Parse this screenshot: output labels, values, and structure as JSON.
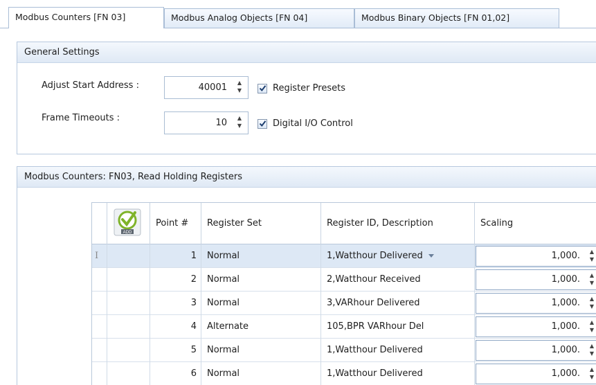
{
  "tabs": [
    {
      "label": "Modbus Counters [FN 03]",
      "active": true
    },
    {
      "label": "Modbus Analog Objects [FN 04]",
      "active": false
    },
    {
      "label": "Modbus Binary Objects  [FN 01,02]",
      "active": false
    }
  ],
  "general": {
    "title": "General Settings",
    "start_label": "Adjust Start Address :",
    "start_value": "40001",
    "timeout_label": "Frame Timeouts :",
    "timeout_value": "10",
    "register_presets": {
      "label": "Register Presets",
      "checked": true
    },
    "digital_io": {
      "label": "Digital I/O Control",
      "checked": true
    }
  },
  "counters": {
    "title": "Modbus Counters: FN03, Read Holding Registers",
    "add_icon_label": "ADD",
    "columns": [
      "Point #",
      "Register Set",
      "Register ID, Description",
      "Scaling"
    ],
    "rows": [
      {
        "point": "1",
        "set": "Normal",
        "reg": "1,Watthour Delivered",
        "scaling": "1,000."
      },
      {
        "point": "2",
        "set": "Normal",
        "reg": "2,Watthour Received",
        "scaling": "1,000."
      },
      {
        "point": "3",
        "set": "Normal",
        "reg": "3,VARhour Delivered",
        "scaling": "1,000."
      },
      {
        "point": "4",
        "set": "Alternate",
        "reg": "105,BPR VARhour Del",
        "scaling": "1,000."
      },
      {
        "point": "5",
        "set": "Normal",
        "reg": "1,Watthour Delivered",
        "scaling": "1,000."
      },
      {
        "point": "6",
        "set": "Normal",
        "reg": "1,Watthour Delivered",
        "scaling": "1,000."
      }
    ]
  },
  "colors": {
    "accent": "#3a6ea5",
    "header_bg": "#dfe9f5",
    "selected_row": "#dde8f5",
    "add_green": "#7fb32a"
  }
}
